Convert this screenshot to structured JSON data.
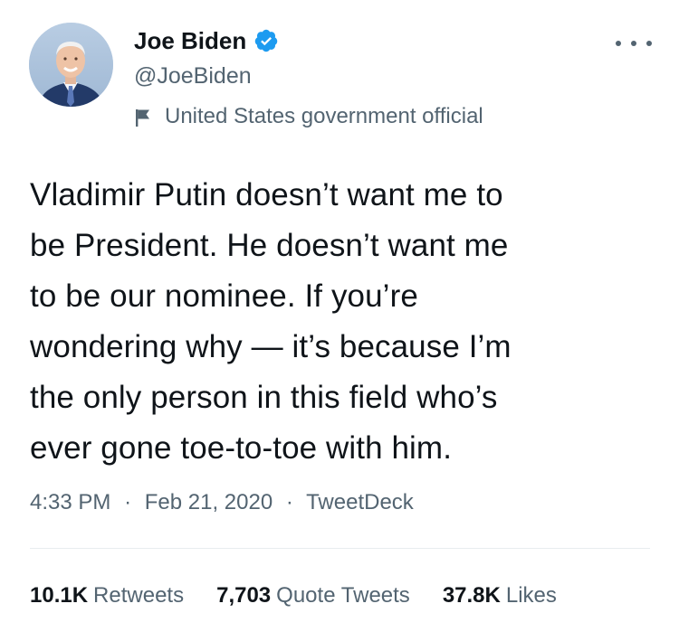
{
  "author": {
    "display_name": "Joe Biden",
    "handle": "@JoeBiden",
    "label": "United States government official"
  },
  "tweet": {
    "text": "Vladimir Putin doesn’t want me to\nbe President. He doesn’t want me\nto be our nominee. If you’re\nwondering why — it’s because I’m\nthe only person in this field who’s\never gone toe-to-toe with him.",
    "time": "4:33 PM",
    "date": "Feb 21, 2020",
    "source": "TweetDeck",
    "separator": "·"
  },
  "stats": {
    "retweets_count": "10.1K",
    "retweets_label": "Retweets",
    "quotes_count": "7,703",
    "quotes_label": "Quote Tweets",
    "likes_count": "37.8K",
    "likes_label": "Likes"
  },
  "icons": {
    "verified": "verified-badge-icon",
    "label": "flag-icon",
    "more": "more-options-icon"
  },
  "colors": {
    "verified_blue": "#1d9bf0",
    "secondary_text": "#536471",
    "primary_text": "#0f1419"
  }
}
